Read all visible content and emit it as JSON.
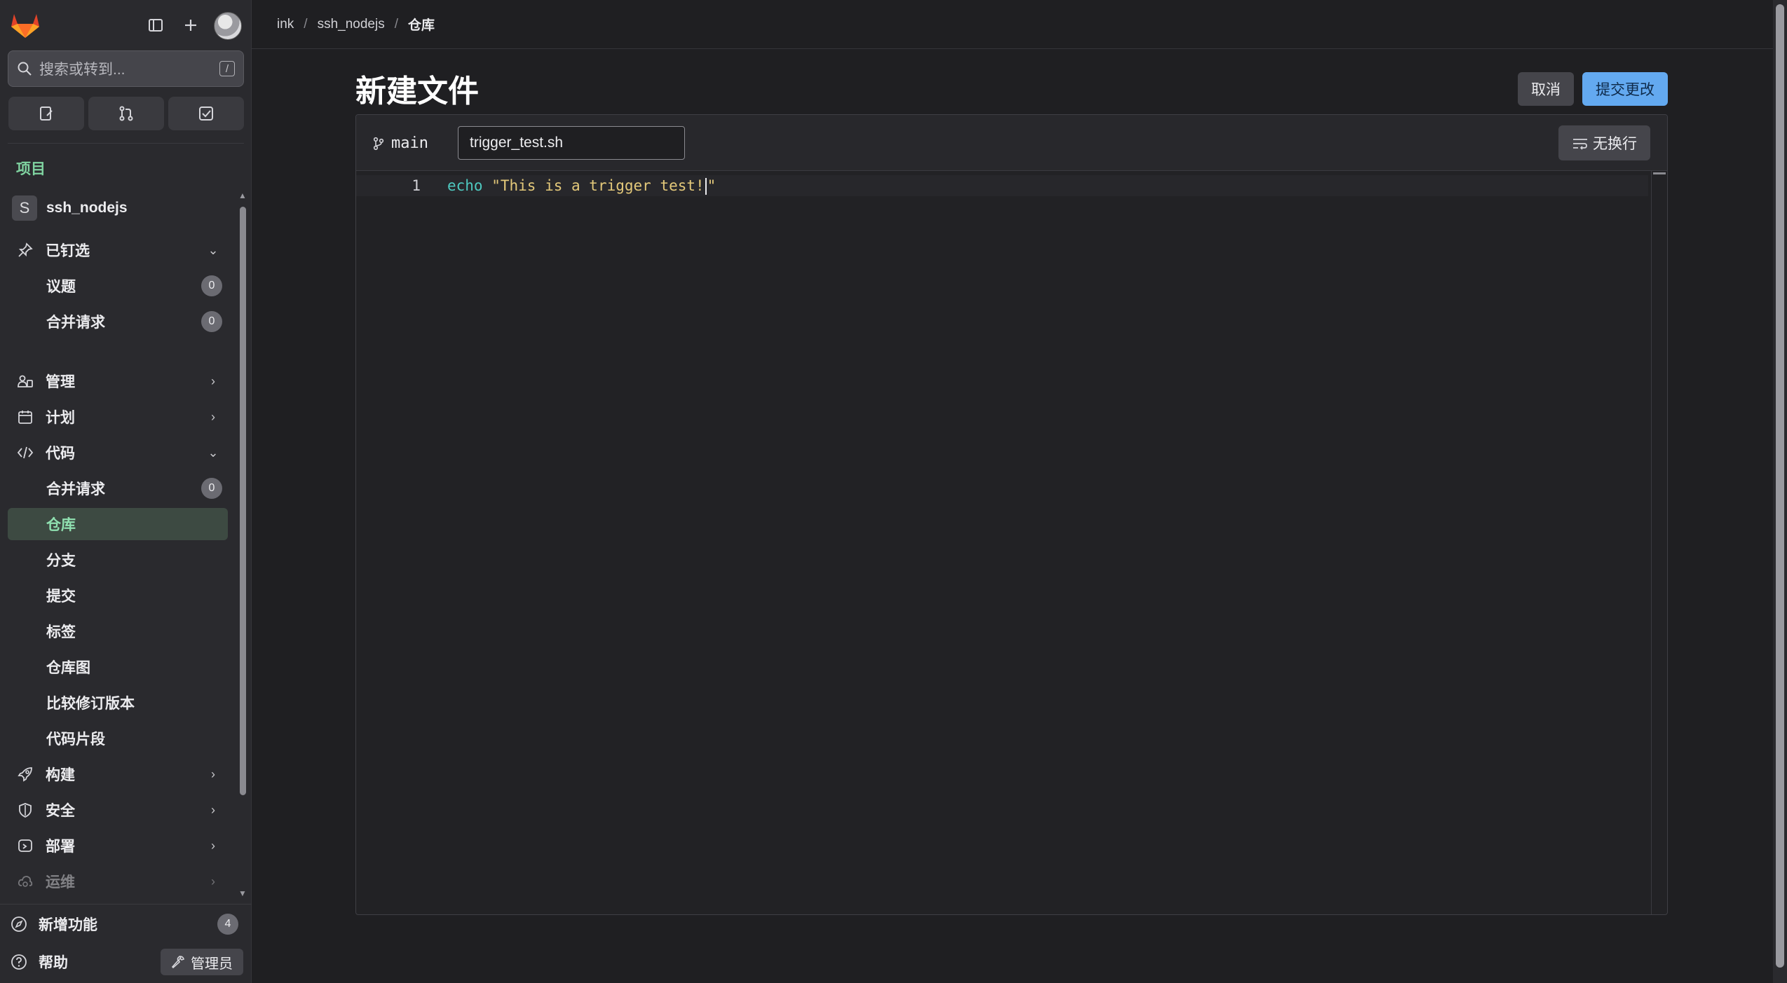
{
  "sidebar": {
    "search_placeholder": "搜索或转到...",
    "search_shortcut": "/",
    "section_title": "项目",
    "project": {
      "badge": "S",
      "name": "ssh_nodejs"
    },
    "pinned": {
      "label": "已钉选",
      "items": [
        {
          "label": "议题",
          "count": "0"
        },
        {
          "label": "合并请求",
          "count": "0"
        }
      ]
    },
    "nav": {
      "manage": "管理",
      "plan": "计划",
      "code": "代码",
      "build": "构建",
      "secure": "安全",
      "deploy": "部署",
      "operate": "运维"
    },
    "code_items": {
      "merge_requests": {
        "label": "合并请求",
        "count": "0"
      },
      "repository": "仓库",
      "branches": "分支",
      "commits": "提交",
      "tags": "标签",
      "graph": "仓库图",
      "compare": "比较修订版本",
      "snippets": "代码片段"
    },
    "bottom": {
      "whats_new": {
        "label": "新增功能",
        "count": "4"
      },
      "help": "帮助",
      "admin": "管理员"
    }
  },
  "breadcrumb": {
    "items": [
      "ink",
      "ssh_nodejs",
      "仓库"
    ],
    "separator": "/"
  },
  "page": {
    "title": "新建文件"
  },
  "actions": {
    "cancel": "取消",
    "commit": "提交更改"
  },
  "editor": {
    "branch": "main",
    "filename": "trigger_test.sh",
    "wrap_button": "无换行",
    "lines": [
      {
        "number": "1",
        "keyword": "echo",
        "string_before_caret": "\"This is a trigger test!",
        "string_after_caret": "\""
      }
    ]
  },
  "colors": {
    "accent": "#63a9f0",
    "active_nav": "#8fe0b0",
    "section_title": "#7fd3a0"
  }
}
